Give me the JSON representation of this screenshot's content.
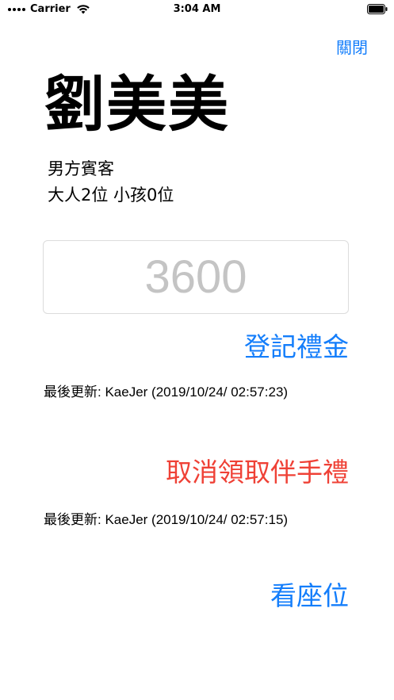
{
  "status_bar": {
    "carrier": "Carrier",
    "time": "3:04 AM"
  },
  "header": {
    "close_label": "關閉"
  },
  "guest": {
    "name": "劉美美",
    "side": "男方賓客",
    "count": "大人2位  小孩0位"
  },
  "gift": {
    "amount_placeholder": "3600",
    "amount_value": "",
    "register_label": "登記禮金",
    "last_updated": "最後更新: KaeJer (2019/10/24/ 02:57:23)"
  },
  "souvenir": {
    "cancel_label": "取消領取伴手禮",
    "last_updated": "最後更新: KaeJer (2019/10/24/ 02:57:15)"
  },
  "seat": {
    "view_label": "看座位"
  },
  "colors": {
    "accent": "#147EFB",
    "destructive": "#EF4136",
    "placeholder": "#C4C4C4"
  }
}
